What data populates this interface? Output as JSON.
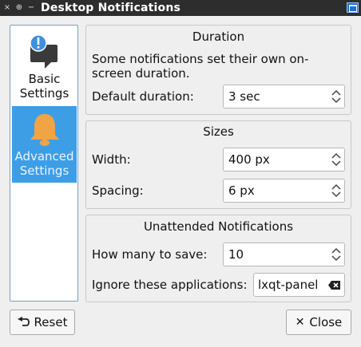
{
  "window": {
    "title": "Desktop Notifications",
    "close_glyph": "×",
    "pin_glyph": "⊕",
    "minimize_glyph": "−"
  },
  "sidebar": {
    "items": [
      {
        "label": "Basic Settings",
        "icon": "notification-bubble-icon",
        "selected": false
      },
      {
        "label": "Advanced Settings",
        "icon": "bell-icon",
        "selected": true
      }
    ]
  },
  "duration": {
    "title": "Duration",
    "description": "Some notifications set their own on-screen duration.",
    "default_label": "Default duration:",
    "default_value": "3 sec"
  },
  "sizes": {
    "title": "Sizes",
    "width_label": "Width:",
    "width_value": "400 px",
    "spacing_label": "Spacing:",
    "spacing_value": "6 px"
  },
  "unattended": {
    "title": "Unattended Notifications",
    "save_label": "How many to save:",
    "save_value": "10",
    "ignore_label": "Ignore these applications:",
    "ignore_value": "lxqt-panel"
  },
  "buttons": {
    "reset": "Reset",
    "close": "Close"
  },
  "colors": {
    "selection": "#3d9ee6",
    "titlebar": "#2d2d2d",
    "bell": "#f0a443"
  }
}
